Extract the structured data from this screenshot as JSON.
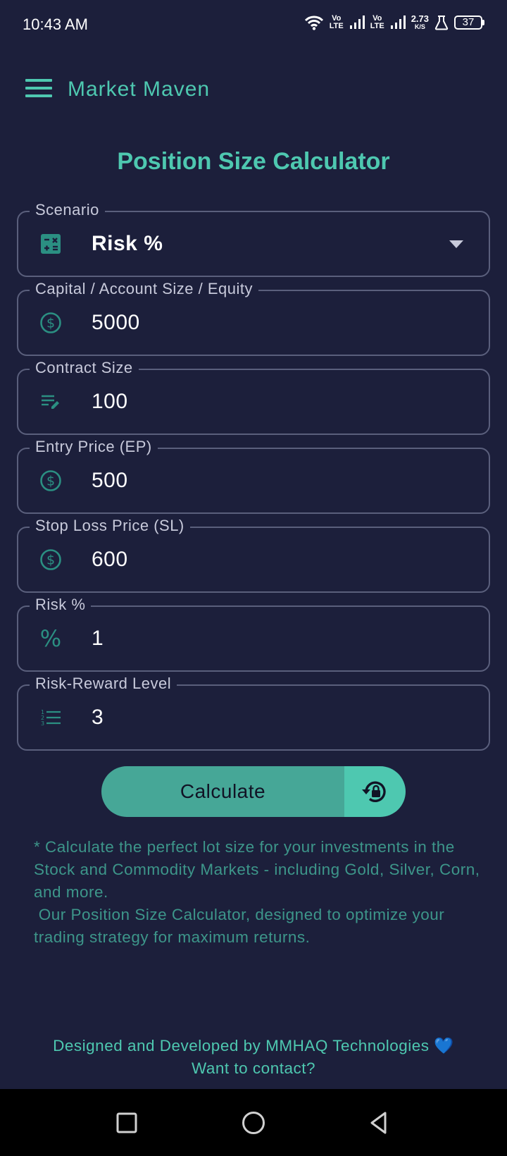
{
  "status_bar": {
    "time": "10:43 AM",
    "volte1": "Vo\nLTE",
    "volte2": "Vo\nLTE",
    "net_speed_value": "2.73",
    "net_speed_unit": "K/S",
    "battery": "37"
  },
  "app_bar": {
    "title": "Market Maven",
    "menu_icon": "hamburger-menu-icon"
  },
  "page_title": "Position Size Calculator",
  "fields": {
    "scenario": {
      "label": "Scenario",
      "value": "Risk %",
      "icon": "calculator-icon"
    },
    "capital": {
      "label": "Capital / Account Size / Equity",
      "value": "5000",
      "icon": "dollar-icon"
    },
    "contract_size": {
      "label": "Contract Size",
      "value": "100",
      "icon": "edit-list-icon"
    },
    "entry_price": {
      "label": "Entry Price (EP)",
      "value": "500",
      "icon": "dollar-icon"
    },
    "stop_loss": {
      "label": "Stop Loss Price (SL)",
      "value": "600",
      "icon": "dollar-icon"
    },
    "risk_percent": {
      "label": "Risk %",
      "value": "1",
      "icon": "percent-icon"
    },
    "risk_reward": {
      "label": "Risk-Reward Level",
      "value": "3",
      "icon": "numbered-list-icon"
    }
  },
  "actions": {
    "calculate_label": "Calculate",
    "reset_icon": "lock-reset-icon"
  },
  "description": {
    "line1": "* Calculate the perfect lot size for your investments in the Stock and Commodity Markets - including Gold, Silver, Corn, and more.",
    "line2": " Our Position Size Calculator, designed to optimize your trading strategy for maximum returns."
  },
  "footer": {
    "credit": "Designed and Developed by MMHAQ Technologies",
    "heart": "💙",
    "contact": "Want to contact?"
  },
  "colors": {
    "background": "#1c1f3b",
    "accent": "#4ec8b0",
    "button": "#46a797",
    "muted_text": "#3d968a",
    "border": "#5a5f7c"
  }
}
